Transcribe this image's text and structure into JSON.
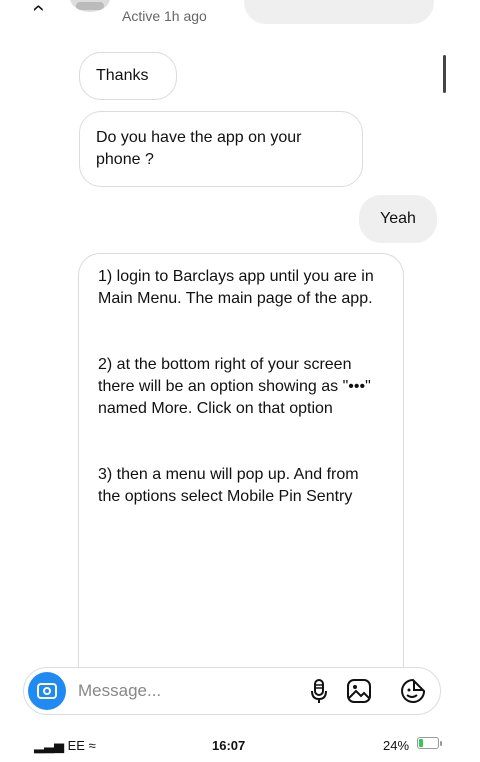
{
  "header": {
    "status": "Active 1h ago",
    "icons": [
      "chevron-left-icon",
      "avatar",
      "phone-icon",
      "video-icon"
    ]
  },
  "messages": [
    {
      "from": "them",
      "text": "Thanks"
    },
    {
      "from": "them",
      "text": "Do you have the app on your phone ?"
    },
    {
      "from": "me",
      "text": "Yeah"
    },
    {
      "from": "them",
      "text": "1) login to Barclays app until you are in Main Menu. The main page of the app.\n\n\n2) at the bottom right of your screen there will be an option showing as \"•••\" named More. Click on that option\n\n\n3) then a menu will pop up. And from the options select Mobile Pin Sentry"
    }
  ],
  "composer": {
    "placeholder": "Message...",
    "icons": [
      "camera-icon",
      "microphone-icon",
      "gallery-icon",
      "sticker-icon"
    ],
    "accent_color": "#1e8af2"
  },
  "statusbar": {
    "carrier": "EE",
    "time": "16:07",
    "battery": "24%",
    "battery_level": 0.24,
    "battery_color": "#34c759"
  }
}
